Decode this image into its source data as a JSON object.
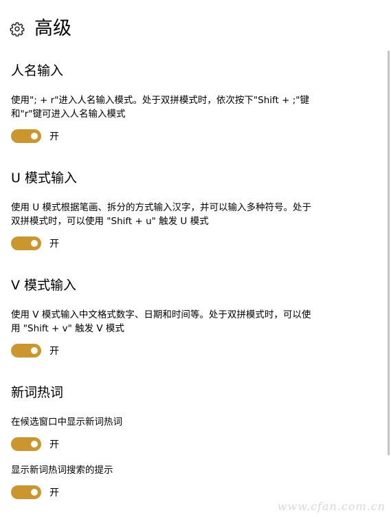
{
  "page": {
    "title": "高级",
    "icon": "gear-icon",
    "accent_color": "#cc962e"
  },
  "sections": [
    {
      "title": "人名输入",
      "description": "使用\"; + r\"进入人名输入模式。处于双拼模式时，依次按下\"Shift + ;\"键和\"r\"键可进入人名输入模式",
      "toggle_state": "开"
    },
    {
      "title": "U 模式输入",
      "description": "使用 U 模式根据笔画、拆分的方式输入汉字，并可以输入多种符号。处于双拼模式时，可以使用 \"Shift + u\" 触发 U 模式",
      "toggle_state": "开"
    },
    {
      "title": "V 模式输入",
      "description": "使用 V 模式输入中文格式数字、日期和时间等。处于双拼模式时，可以使用 \"Shift + v\" 触发 V 模式",
      "toggle_state": "开"
    },
    {
      "title": "新词热词",
      "settings": [
        {
          "label": "在候选窗口中显示新词热词",
          "toggle_state": "开"
        },
        {
          "label": "显示新词热词搜索的提示",
          "toggle_state": "开"
        }
      ]
    }
  ],
  "watermark": "www.cfan.com.cn"
}
